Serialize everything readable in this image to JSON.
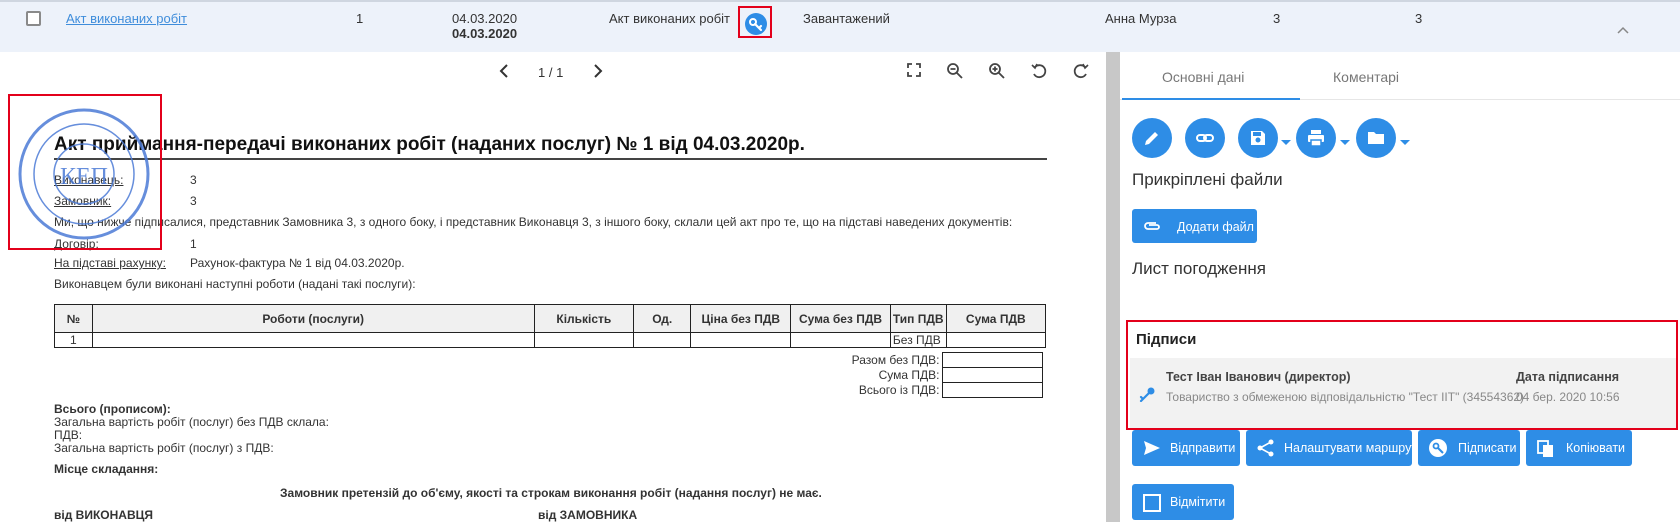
{
  "row": {
    "doc_name": "Акт виконаних робіт",
    "number": "1",
    "date1": "04.03.2020",
    "date2": "04.03.2020",
    "doc_type": "Акт виконаних робіт",
    "status": "Завантажений",
    "person": "Анна Мурза",
    "col_a": "3",
    "col_b": "3",
    "sign_icon": "key-icon",
    "collapse_icon": "chevron-up-icon"
  },
  "viewer": {
    "page_indicator": "1 / 1",
    "tools": [
      "fullscreen-icon",
      "zoom-out-icon",
      "zoom-in-icon",
      "rotate-left-icon",
      "rotate-right-icon"
    ]
  },
  "document": {
    "title": "Акт приймання-передачі виконаних робіт (наданих послуг) № 1 від 04.03.2020р.",
    "executor_label": "Виконавець:",
    "executor_value": "3",
    "customer_label": "Замовник:",
    "customer_value": "3",
    "intro": "Ми, що нижче підписалися, представник Замовника 3, з одного боку, і представник Виконавця 3, з іншого боку, склали цей акт про те, що на підставі наведених документів:",
    "contract_label": "Договір:",
    "contract_value": "1",
    "invoice_label": "На підставі рахунку:",
    "invoice_value": "Рахунок-фактура № 1 від 04.03.2020р.",
    "works_intro": "Виконавцем були виконані наступні роботи (надані такі послуги):",
    "table_headers": [
      "№",
      "Роботи (послуги)",
      "Кількість",
      "Од.",
      "Ціна без ПДВ",
      "Сума без ПДВ",
      "Тип ПДВ",
      "Сума ПДВ"
    ],
    "table_rows": [
      [
        "1",
        "",
        "",
        "",
        "",
        "",
        "Без ПДВ",
        ""
      ]
    ],
    "total_labels": [
      "Разом без ПДВ:",
      "Сума ПДВ:",
      "Всього із ПДВ:"
    ],
    "total_words_label": "Всього (прописом):",
    "total_text_1": "Загальна вартість робіт (послуг) без ПДВ склала:",
    "vat_label": "ПДВ:",
    "total_text_2": "Загальна вартість робіт (послуг) з ПДВ:",
    "place_label": "Місце складання:",
    "no_claims": "Замовник претензій до об'єму, якості та строкам виконання робіт (надання послуг) не має.",
    "from_executor": "від ВИКОНАВЦЯ",
    "from_customer": "від ЗАМОВНИКА",
    "stamp_text": "КЕП",
    "stamp_icon": "seal-stamp-icon"
  },
  "panel": {
    "tabs": [
      "Основні дані",
      "Коментарі"
    ],
    "actions": [
      "edit-icon",
      "link-icon",
      "save-icon",
      "print-icon",
      "folder-icon"
    ],
    "attached_title": "Прикріплені файли",
    "add_file": "Додати файл",
    "approval_title": "Лист погодження",
    "signatures_title": "Підписи",
    "signer_name": "Тест Іван Іванович (директор)",
    "signer_org": "Товариство з обмеженою відповідальністю \"Тест IIT\" (34554362)",
    "sign_date_label": "Дата підписання",
    "sign_date": "04 бер. 2020 10:56",
    "buttons": [
      "Відправити",
      "Налаштувати маршрут",
      "Підписати",
      "Копіювати",
      "Відмітити"
    ]
  },
  "colors": {
    "accent": "#2e8de6",
    "highlight": "#e3001b",
    "row_bg": "#edf2fa"
  }
}
